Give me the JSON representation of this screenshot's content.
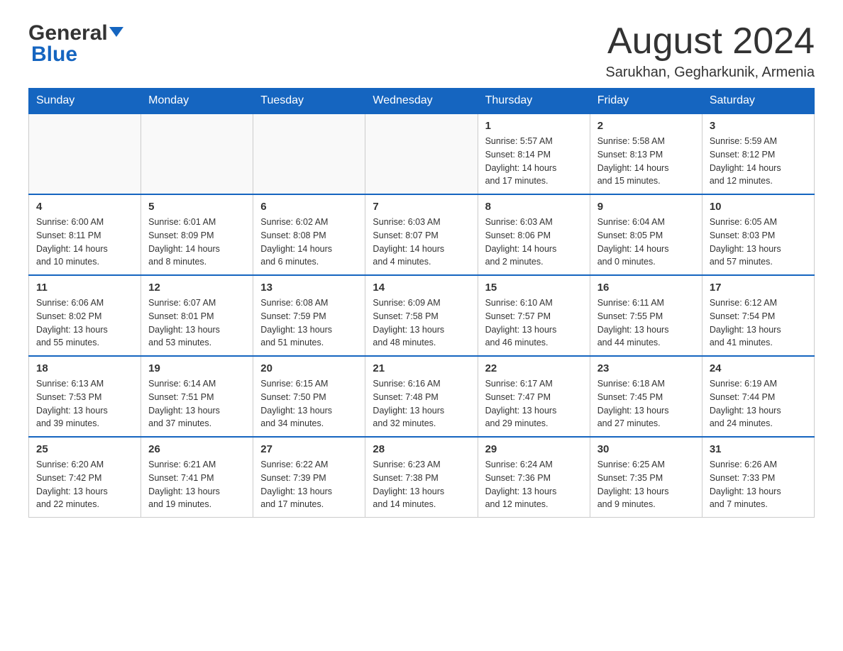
{
  "header": {
    "logo_general": "General",
    "logo_blue": "Blue",
    "month_title": "August 2024",
    "location": "Sarukhan, Gegharkunik, Armenia"
  },
  "days_of_week": [
    "Sunday",
    "Monday",
    "Tuesday",
    "Wednesday",
    "Thursday",
    "Friday",
    "Saturday"
  ],
  "weeks": [
    [
      {
        "day": "",
        "info": ""
      },
      {
        "day": "",
        "info": ""
      },
      {
        "day": "",
        "info": ""
      },
      {
        "day": "",
        "info": ""
      },
      {
        "day": "1",
        "info": "Sunrise: 5:57 AM\nSunset: 8:14 PM\nDaylight: 14 hours\nand 17 minutes."
      },
      {
        "day": "2",
        "info": "Sunrise: 5:58 AM\nSunset: 8:13 PM\nDaylight: 14 hours\nand 15 minutes."
      },
      {
        "day": "3",
        "info": "Sunrise: 5:59 AM\nSunset: 8:12 PM\nDaylight: 14 hours\nand 12 minutes."
      }
    ],
    [
      {
        "day": "4",
        "info": "Sunrise: 6:00 AM\nSunset: 8:11 PM\nDaylight: 14 hours\nand 10 minutes."
      },
      {
        "day": "5",
        "info": "Sunrise: 6:01 AM\nSunset: 8:09 PM\nDaylight: 14 hours\nand 8 minutes."
      },
      {
        "day": "6",
        "info": "Sunrise: 6:02 AM\nSunset: 8:08 PM\nDaylight: 14 hours\nand 6 minutes."
      },
      {
        "day": "7",
        "info": "Sunrise: 6:03 AM\nSunset: 8:07 PM\nDaylight: 14 hours\nand 4 minutes."
      },
      {
        "day": "8",
        "info": "Sunrise: 6:03 AM\nSunset: 8:06 PM\nDaylight: 14 hours\nand 2 minutes."
      },
      {
        "day": "9",
        "info": "Sunrise: 6:04 AM\nSunset: 8:05 PM\nDaylight: 14 hours\nand 0 minutes."
      },
      {
        "day": "10",
        "info": "Sunrise: 6:05 AM\nSunset: 8:03 PM\nDaylight: 13 hours\nand 57 minutes."
      }
    ],
    [
      {
        "day": "11",
        "info": "Sunrise: 6:06 AM\nSunset: 8:02 PM\nDaylight: 13 hours\nand 55 minutes."
      },
      {
        "day": "12",
        "info": "Sunrise: 6:07 AM\nSunset: 8:01 PM\nDaylight: 13 hours\nand 53 minutes."
      },
      {
        "day": "13",
        "info": "Sunrise: 6:08 AM\nSunset: 7:59 PM\nDaylight: 13 hours\nand 51 minutes."
      },
      {
        "day": "14",
        "info": "Sunrise: 6:09 AM\nSunset: 7:58 PM\nDaylight: 13 hours\nand 48 minutes."
      },
      {
        "day": "15",
        "info": "Sunrise: 6:10 AM\nSunset: 7:57 PM\nDaylight: 13 hours\nand 46 minutes."
      },
      {
        "day": "16",
        "info": "Sunrise: 6:11 AM\nSunset: 7:55 PM\nDaylight: 13 hours\nand 44 minutes."
      },
      {
        "day": "17",
        "info": "Sunrise: 6:12 AM\nSunset: 7:54 PM\nDaylight: 13 hours\nand 41 minutes."
      }
    ],
    [
      {
        "day": "18",
        "info": "Sunrise: 6:13 AM\nSunset: 7:53 PM\nDaylight: 13 hours\nand 39 minutes."
      },
      {
        "day": "19",
        "info": "Sunrise: 6:14 AM\nSunset: 7:51 PM\nDaylight: 13 hours\nand 37 minutes."
      },
      {
        "day": "20",
        "info": "Sunrise: 6:15 AM\nSunset: 7:50 PM\nDaylight: 13 hours\nand 34 minutes."
      },
      {
        "day": "21",
        "info": "Sunrise: 6:16 AM\nSunset: 7:48 PM\nDaylight: 13 hours\nand 32 minutes."
      },
      {
        "day": "22",
        "info": "Sunrise: 6:17 AM\nSunset: 7:47 PM\nDaylight: 13 hours\nand 29 minutes."
      },
      {
        "day": "23",
        "info": "Sunrise: 6:18 AM\nSunset: 7:45 PM\nDaylight: 13 hours\nand 27 minutes."
      },
      {
        "day": "24",
        "info": "Sunrise: 6:19 AM\nSunset: 7:44 PM\nDaylight: 13 hours\nand 24 minutes."
      }
    ],
    [
      {
        "day": "25",
        "info": "Sunrise: 6:20 AM\nSunset: 7:42 PM\nDaylight: 13 hours\nand 22 minutes."
      },
      {
        "day": "26",
        "info": "Sunrise: 6:21 AM\nSunset: 7:41 PM\nDaylight: 13 hours\nand 19 minutes."
      },
      {
        "day": "27",
        "info": "Sunrise: 6:22 AM\nSunset: 7:39 PM\nDaylight: 13 hours\nand 17 minutes."
      },
      {
        "day": "28",
        "info": "Sunrise: 6:23 AM\nSunset: 7:38 PM\nDaylight: 13 hours\nand 14 minutes."
      },
      {
        "day": "29",
        "info": "Sunrise: 6:24 AM\nSunset: 7:36 PM\nDaylight: 13 hours\nand 12 minutes."
      },
      {
        "day": "30",
        "info": "Sunrise: 6:25 AM\nSunset: 7:35 PM\nDaylight: 13 hours\nand 9 minutes."
      },
      {
        "day": "31",
        "info": "Sunrise: 6:26 AM\nSunset: 7:33 PM\nDaylight: 13 hours\nand 7 minutes."
      }
    ]
  ]
}
